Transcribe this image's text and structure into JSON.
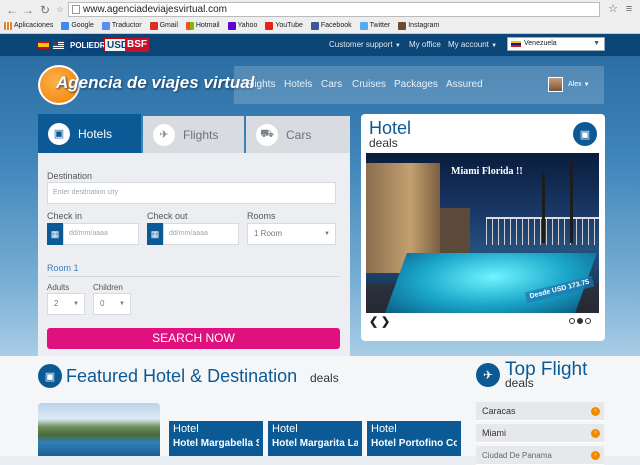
{
  "browser": {
    "url": "www.agenciadeviajesvirtual.com",
    "bookmarks": [
      {
        "label": "Aplicaciones",
        "icon": "apps-grid-icon",
        "color": "#e0842b"
      },
      {
        "label": "Google",
        "icon": "google-icon",
        "color": "#4285f4"
      },
      {
        "label": "Traductor",
        "icon": "translate-icon",
        "color": "#5a8ef0"
      },
      {
        "label": "Gmail",
        "icon": "gmail-icon",
        "color": "#d93025"
      },
      {
        "label": "Hotmail",
        "icon": "windows-icon",
        "color": "#f25022"
      },
      {
        "label": "Yahoo",
        "icon": "yahoo-icon",
        "color": "#5f01d1"
      },
      {
        "label": "YouTube",
        "icon": "youtube-icon",
        "color": "#e62117"
      },
      {
        "label": "Facebook",
        "icon": "facebook-icon",
        "color": "#3b5998"
      },
      {
        "label": "Twitter",
        "icon": "twitter-icon",
        "color": "#55acee"
      },
      {
        "label": "Instagram",
        "icon": "instagram-icon",
        "color": "#6e4a35"
      }
    ]
  },
  "topbar": {
    "brand_poliedro": "POLIEDRO",
    "brand_usd": "USD",
    "brand_bsf": "BSF",
    "customer_support": "Customer support",
    "my_office": "My office",
    "my_account": "My account",
    "country": "Venezuela"
  },
  "header": {
    "logo_text": "Agencia de viajes virtual",
    "nav": [
      "Flights",
      "Hotels",
      "Cars",
      "Cruises",
      "Packages",
      "Assured"
    ],
    "user": "Alex"
  },
  "search": {
    "tabs": [
      "Hotels",
      "Flights",
      "Cars"
    ],
    "destination_label": "Destination",
    "destination_placeholder": "Enter destination city",
    "checkin_label": "Check in",
    "checkin_placeholder": "dd/mm/aaaa",
    "checkout_label": "Check out",
    "checkout_placeholder": "dd/mm/aaaa",
    "rooms_label": "Rooms",
    "rooms_value": "1 Room",
    "room_heading": "Room 1",
    "adults_label": "Adults",
    "adults_value": "2",
    "children_label": "Children",
    "children_value": "0",
    "search_button": "SEARCH NOW"
  },
  "deals": {
    "title": "Hotel",
    "subtitle": "deals",
    "caption": "Miami Florida !!",
    "price": "Desde USD 173.75"
  },
  "featured": {
    "title": "Featured Hotel & Destination",
    "suffix": "deals",
    "cards": [
      {
        "kind": "Hotel",
        "name": "Hotel Margabella Suites"
      },
      {
        "kind": "Hotel",
        "name": "Hotel Margarita Lagunamar"
      },
      {
        "kind": "Hotel",
        "name": "Hotel Portofino Complex"
      }
    ]
  },
  "topflight": {
    "title": "Top Flight",
    "subtitle": "deals",
    "cities": [
      "Caracas",
      "Miami",
      "Ciudad De Panama"
    ]
  },
  "colors": {
    "primary": "#0b5a96",
    "accent": "#e0117f",
    "header": "#0b4677"
  }
}
